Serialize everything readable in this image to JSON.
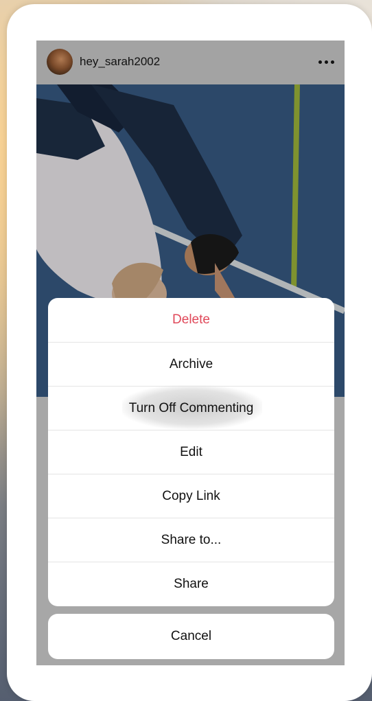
{
  "post": {
    "username": "hey_sarah2002"
  },
  "action_sheet": {
    "items": [
      {
        "label": "Delete",
        "style": "destructive",
        "color": "#e0495a"
      },
      {
        "label": "Archive"
      },
      {
        "label": "Turn Off Commenting",
        "state": "pressed"
      },
      {
        "label": "Edit"
      },
      {
        "label": "Copy Link"
      },
      {
        "label": "Share to..."
      },
      {
        "label": "Share"
      }
    ],
    "cancel_label": "Cancel"
  },
  "icons": {
    "more": "more-horizontal-icon",
    "avatar": "avatar"
  }
}
